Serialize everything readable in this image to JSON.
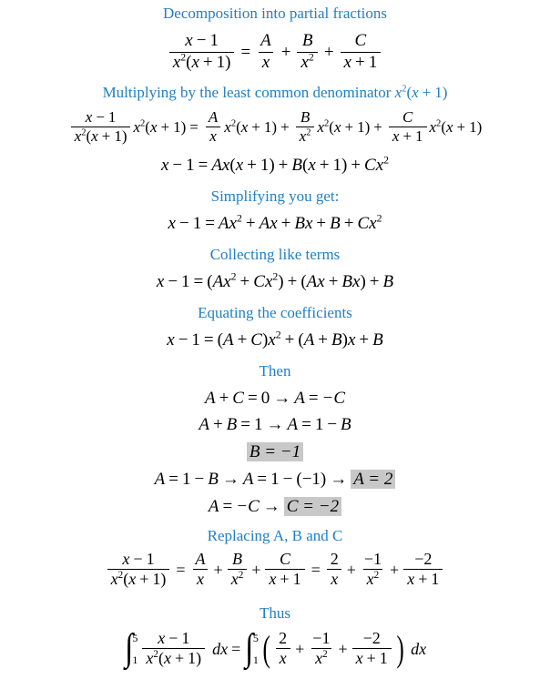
{
  "document": {
    "title": "Decomposition into partial fractions",
    "accent_color": "#1f7fc4",
    "highlight_color": "#c8c8c8",
    "text_color": "#000000",
    "background_color": "#ffffff"
  },
  "headings": {
    "h1": "Decomposition into partial fractions",
    "h2_prefix": "Multiplying by the least common denominator ",
    "h3": "Simplifying you get:",
    "h4": "Collecting like terms",
    "h5": "Equating the coefficients",
    "h6": "Then",
    "h7": "Replacing A, B and C",
    "h8": "Thus"
  },
  "math": {
    "x": "x",
    "A": "A",
    "B": "B",
    "C": "C",
    "d": "d",
    "one": "1",
    "two": "2",
    "zero": "0",
    "five": "5",
    "sq": "2",
    "eq": "=",
    "plus": "+",
    "minus": "−",
    "arrow": "→",
    "lparen": "(",
    "rparen": ")",
    "neg_one": "−1",
    "neg_two": "−2",
    "minus_C": "−C",
    "minus_B": "− B",
    "int_symbol": "∫"
  },
  "equations": {
    "eq1": {
      "lhs_num": "x − 1",
      "lhs_den": "x²(x + 1)",
      "rel": "=",
      "t1_num": "A",
      "t1_den": "x",
      "t2_num": "B",
      "t2_den": "x²",
      "t3_num": "C",
      "t3_den": "x + 1"
    },
    "eq2": {
      "text": "(x − 1)/(x²(x+1)) · x²(x+1) = A/x · x²(x+1) + B/x² · x²(x+1) + C/(x+1) · x²(x+1)"
    },
    "eq3": "x − 1 = Ax(x + 1) + B(x + 1) + Cx²",
    "eq4": "x − 1 = Ax² + Ax + Bx + B + Cx²",
    "eq5": "x − 1 = (Ax² + Cx²) + (Ax + Bx) + B",
    "eq6": "x − 1 = (A + C)x² + (A + B)x + B",
    "eq7": "A + C = 0 → A = −C",
    "eq8": "A + B = 1 → A = 1 − B",
    "eq9_highlight": "B = −1",
    "eq10_prefix": "A = 1 − B → A = 1 − (−1) → ",
    "eq10_highlight": "A = 2",
    "eq11_prefix": "A = −C → ",
    "eq11_highlight": "C = −2",
    "eq12": {
      "lhs_num": "x − 1",
      "lhs_den": "x²(x + 1)",
      "mid": "A/x + B/x² + C/(x+1)",
      "rhs": "2/x + (−1)/x² + (−2)/(x+1)"
    },
    "eq13": {
      "lower_limit": "1",
      "upper_limit": "5",
      "integrand_num": "x − 1",
      "integrand_den": "x²(x + 1)",
      "differential": "dx",
      "rhs_terms": [
        "2/x",
        "−1/x²",
        "−2/(x + 1)"
      ]
    }
  }
}
